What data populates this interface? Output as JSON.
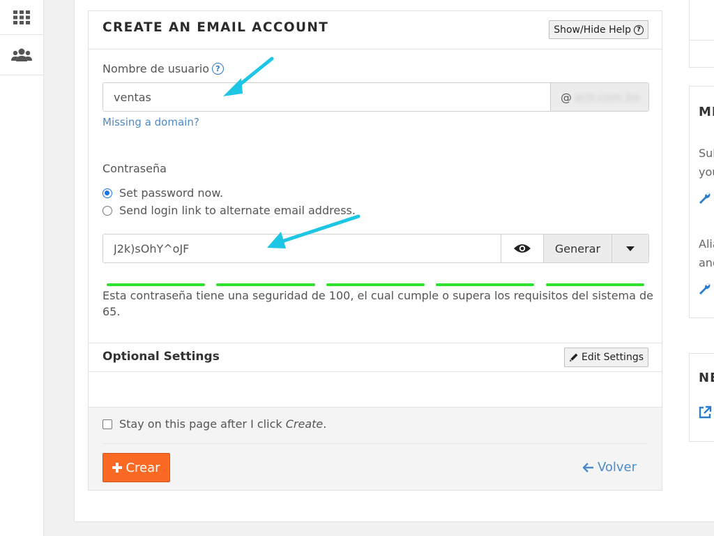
{
  "card": {
    "title": "CREATE AN EMAIL ACCOUNT",
    "help_button": "Show/Hide Help"
  },
  "username": {
    "label": "Nombre de usuario",
    "value": "ventas",
    "at": "@",
    "domain_blurred": "acti.com.bo",
    "missing_domain_link": "Missing a domain?"
  },
  "password": {
    "label": "Contraseña",
    "option_now": "Set password now.",
    "option_link": "Send login link to alternate email address.",
    "selected_option": "Set password now.",
    "value": "J2k)sOhY^oJF",
    "generate_label": "Generar",
    "strength_text": "Esta contraseña tiene una seguridad de 100, el cual cumple o supera los requisitos del sistema de 65.",
    "strength_score": 100,
    "meter_color": "#2fe02f"
  },
  "optional": {
    "title": "Optional Settings",
    "edit_button": "Edit Settings"
  },
  "footer": {
    "stay_prefix": "Stay on this page after I click ",
    "stay_emphasis": "Create",
    "stay_suffix": ".",
    "stay_checked": false,
    "create_label": "Crear",
    "back_label": "Volver"
  },
  "side": {
    "card2_title": "MI",
    "card2_text1": "Sub",
    "card2_text2": "you",
    "card2_text3": "Alia",
    "card2_text4": "and",
    "card3_title": "NE"
  },
  "colors": {
    "accent": "#2a7ccc",
    "create_button": "#fb6a24",
    "arrow": "#1ec6e6",
    "radio": "#1a73e8"
  }
}
